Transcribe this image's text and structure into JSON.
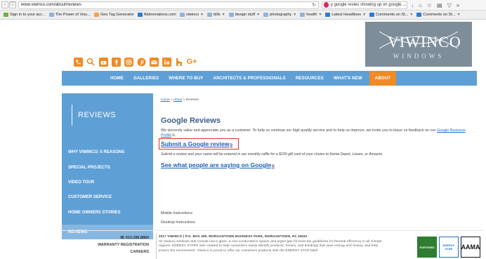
{
  "browser": {
    "url": "www.viwinco.com/about/reviews",
    "search_text": "y google revies showing up on google.→",
    "bookmarks": [
      {
        "label": "Sign in to your acc...",
        "icon": "google-icon",
        "has_menu": false
      },
      {
        "label": "The Power of Visu...",
        "icon": "globe-icon",
        "has_menu": false
      },
      {
        "label": "Geo Tag Generator",
        "icon": "geotag-icon",
        "has_menu": false
      },
      {
        "label": "Abbreviations.com",
        "icon": "abbrev-icon",
        "has_menu": false
      },
      {
        "label": "viwinco",
        "icon": "folder-icon",
        "has_menu": true
      },
      {
        "label": "bills",
        "icon": "folder-icon",
        "has_menu": true
      },
      {
        "label": "design stuff",
        "icon": "folder-icon",
        "has_menu": true
      },
      {
        "label": "photography",
        "icon": "folder-icon",
        "has_menu": true
      },
      {
        "label": "health",
        "icon": "folder-icon",
        "has_menu": true
      },
      {
        "label": "Latest Headlines",
        "icon": "feed-icon",
        "has_menu": true
      },
      {
        "label": "Comments on St...",
        "icon": "feed-icon",
        "has_menu": true
      },
      {
        "label": "Comments on St...",
        "icon": "feed-icon",
        "has_menu": true
      }
    ]
  },
  "site": {
    "logo": {
      "word": "VIWINCO",
      "sub": "WINDOWS"
    },
    "social_icons": [
      "phone-icon",
      "search-icon",
      "youtube-icon",
      "facebook-icon",
      "instagram-icon",
      "pinterest-icon",
      "email-icon",
      "linkedin-icon",
      "houzz-icon",
      "google-plus-icon"
    ],
    "nav": [
      "HOME",
      "GALLERIES",
      "WHERE TO BUY",
      "ARCHITECTS & PROFESSIONALS",
      "RESOURCES",
      "WHAT'S NEW",
      "ABOUT"
    ],
    "nav_active": "ABOUT",
    "sidebar": {
      "title": "REVIEWS",
      "items": [
        "WHY VIWINCO: 5 REASONS",
        "SPECIAL PROJECTS",
        "VIDEO TOUR",
        "CUSTOMER SERVICE",
        "HOME OWNERS STORIES",
        "REVIEWS"
      ],
      "active": "REVIEWS"
    },
    "content": {
      "breadcrumb": [
        "Home",
        "About",
        "Reviews"
      ],
      "title": "Google Reviews",
      "intro": "We sincerely value and appreciate you as a customer. To help us continue our high quality service and to help us improve, we invite you to leave us  feedback on our",
      "intro_link": "Google Business Profile",
      "submit_link": "Submit a Google review",
      "submit_note": "Submit a review and your name will be entered in our monthly raffle for a $100 gift card of your choice to Home Depot, Lowes, or Amazon.",
      "see_link": "See what people are saying on Google",
      "mobile": "Mobile Instructions",
      "desktop": "Desktop Instructions"
    },
    "footer": {
      "phone": "610.286.8884",
      "links": [
        "WARRANTY REGISTRATION",
        "CAREERS"
      ],
      "lead": "2017 VIWINCO | P.O. BOX 499, MORGANTOWN BUSINESS PARK, MORGANTOWN, PA 19543",
      "body": "All Viwinco windows that include low-e glass, a non-conductance spacer and argon gas fill meet the guidelines for thermal efficiency in all climate regions. ENERGY STAR® was created to help consumers easily identify products, homes, and buildings that save energy and money, and help protect the environment. Viwinco is proud to offer our customers products with the ENERGY STAR label.",
      "badges": [
        "FORTIFIED",
        "ENERGY STAR",
        "AAMA"
      ]
    }
  },
  "colors": {
    "nav_blue": "#5e9fd5",
    "accent_orange": "#f08a24",
    "highlight_red": "#e0302b",
    "link_blue": "#1a5fb4"
  }
}
